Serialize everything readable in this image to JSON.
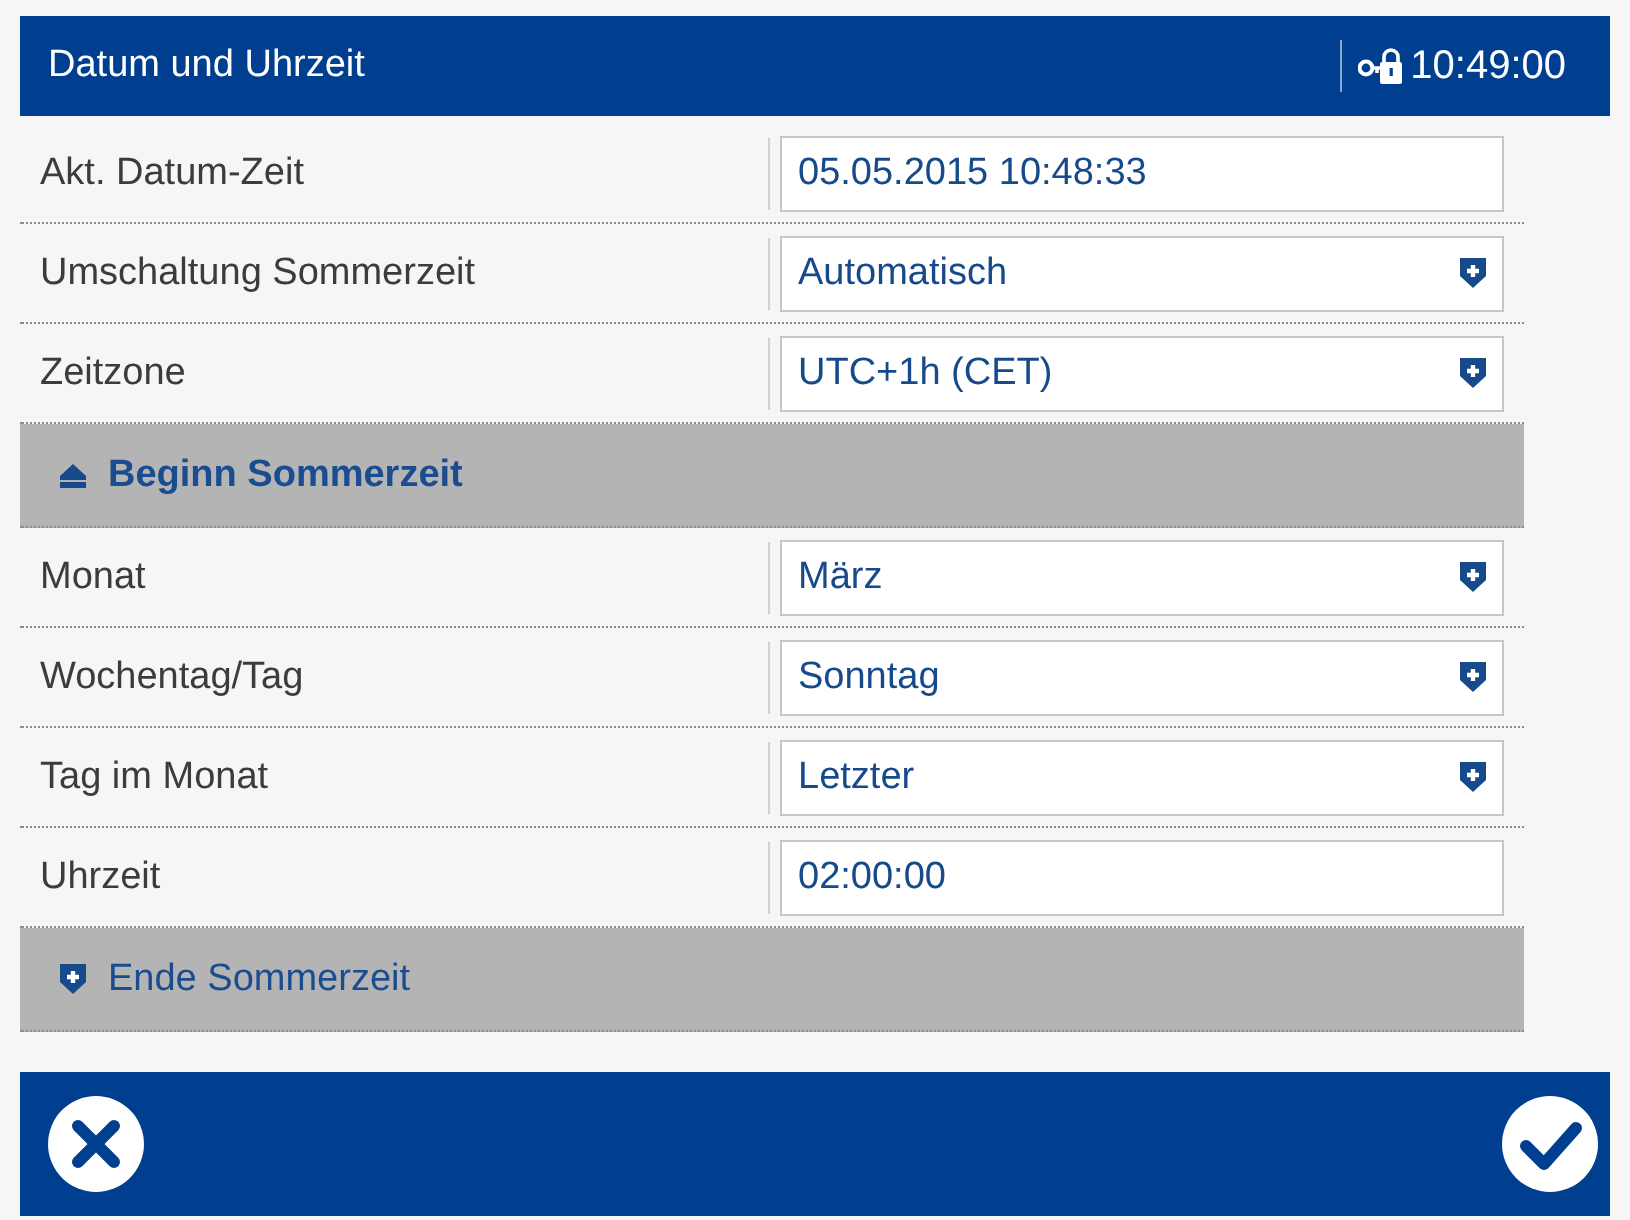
{
  "window": {
    "title": "Datum und Uhrzeit",
    "clock": "10:49:00"
  },
  "rows": [
    {
      "kind": "text",
      "label": "Akt. Datum-Zeit",
      "value": "05.05.2015 10:48:33"
    },
    {
      "kind": "dropdown",
      "label": "Umschaltung Sommerzeit",
      "value": "Automatisch"
    },
    {
      "kind": "dropdown",
      "label": "Zeitzone",
      "value": "UTC+1h (CET)"
    },
    {
      "kind": "section",
      "label": "Beginn Sommerzeit",
      "expanded": true,
      "children": [
        {
          "kind": "dropdown",
          "label": "Monat",
          "value": "März"
        },
        {
          "kind": "dropdown",
          "label": "Wochentag/Tag",
          "value": "Sonntag"
        },
        {
          "kind": "dropdown",
          "label": "Tag im Monat",
          "value": "Letzter"
        },
        {
          "kind": "text",
          "label": "Uhrzeit",
          "value": "02:00:00"
        }
      ]
    },
    {
      "kind": "section",
      "label": "Ende Sommerzeit",
      "expanded": false
    }
  ]
}
